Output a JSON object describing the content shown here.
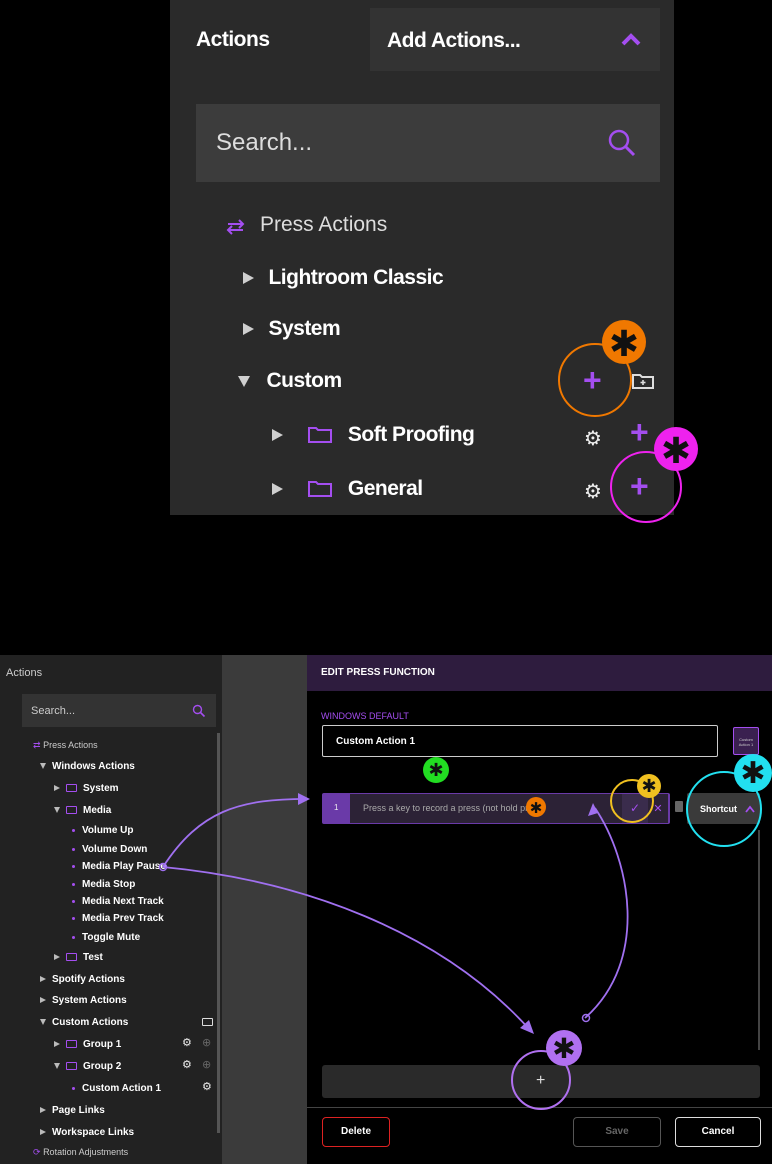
{
  "top": {
    "actions_label": "Actions",
    "dropdown_label": "Add Actions...",
    "search_placeholder": "Search...",
    "press_actions": "Press Actions",
    "tree": [
      {
        "label": "Lightroom Classic"
      },
      {
        "label": "System"
      },
      {
        "label": "Custom"
      },
      {
        "label": "Soft Proofing"
      },
      {
        "label": "General"
      }
    ]
  },
  "sidebar": {
    "title": "Actions",
    "search_placeholder": "Search...",
    "press_actions": "Press Actions",
    "items": [
      {
        "label": "Windows Actions"
      },
      {
        "label": "System"
      },
      {
        "label": "Media"
      },
      {
        "label": "Volume Up"
      },
      {
        "label": "Volume Down"
      },
      {
        "label": "Media Play Pause"
      },
      {
        "label": "Media Stop"
      },
      {
        "label": "Media Next Track"
      },
      {
        "label": "Media Prev Track"
      },
      {
        "label": "Toggle Mute"
      },
      {
        "label": "Test"
      },
      {
        "label": "Spotify Actions"
      },
      {
        "label": "System Actions"
      },
      {
        "label": "Custom Actions"
      },
      {
        "label": "Group 1"
      },
      {
        "label": "Group 2"
      },
      {
        "label": "Custom Action 1"
      },
      {
        "label": "Page Links"
      },
      {
        "label": "Workspace Links"
      },
      {
        "label": "Rotation Adjustments"
      }
    ]
  },
  "dialog": {
    "title": "EDIT PRESS FUNCTION",
    "section_label": "WINDOWS DEFAULT",
    "name_value": "Custom Action 1",
    "icon_text": "Custom Action 1",
    "row_number": "1",
    "row_placeholder": "Press a key to record a press (not hold press)",
    "shortcut_label": "Shortcut",
    "add_symbol": "+",
    "delete_label": "Delete",
    "save_label": "Save",
    "cancel_label": "Cancel"
  },
  "colors": {
    "accent_purple": "#a44ef0",
    "callout_orange": "#f07800",
    "callout_magenta": "#ee22ee",
    "callout_green": "#22dd22",
    "callout_yellow": "#f0c020",
    "callout_cyan": "#22e0f0",
    "callout_lavender": "#b070f0"
  }
}
